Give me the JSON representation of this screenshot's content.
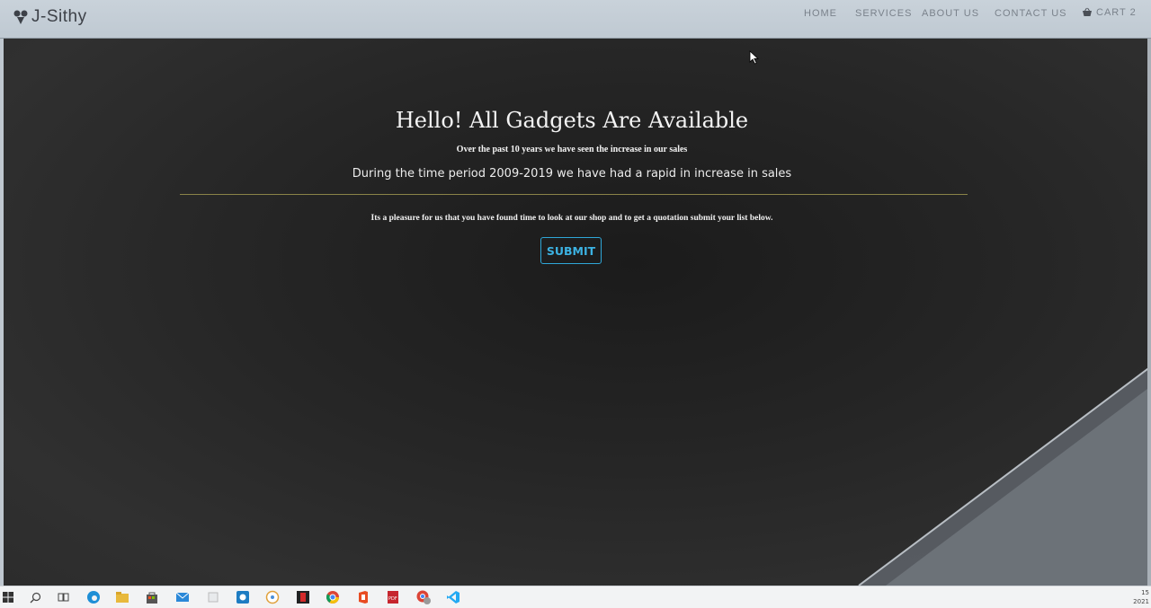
{
  "brand": {
    "name": "J-Sithy",
    "icon": "brand-logo-icon"
  },
  "nav": {
    "items": [
      {
        "label": "HOME"
      },
      {
        "label": "SERVICES"
      },
      {
        "label": "ABOUT US"
      },
      {
        "label": "CONTACT US"
      }
    ],
    "cart": {
      "label": "CART 2",
      "icon": "cart-icon"
    }
  },
  "hero": {
    "title": "Hello! All Gadgets Are Available",
    "subtitle": "Over the past 10 years we have seen the increase in our sales",
    "description": "During the time period 2009-2019 we have had a rapid in increase in sales",
    "note": "Its a pleasure for us that you have found time to look at our shop and to get a quotation submit your list below.",
    "submit_label": "SUBMIT"
  },
  "colors": {
    "navbar_bg": "#c9d2da",
    "page_bg": "#262626",
    "accent": "#3cb2e2",
    "divider": "#8a8348"
  },
  "taskbar": {
    "icons": [
      "windows-start-icon",
      "search-icon",
      "task-view-icon",
      "edge-icon",
      "file-explorer-icon",
      "store-icon",
      "mail-icon",
      "app-icon",
      "camera-icon",
      "maps-icon",
      "app-red-icon",
      "chrome-icon",
      "office-icon",
      "pdf-icon",
      "chrome-alt-icon",
      "vscode-icon"
    ],
    "clock_time": "15",
    "clock_date": "2021"
  }
}
